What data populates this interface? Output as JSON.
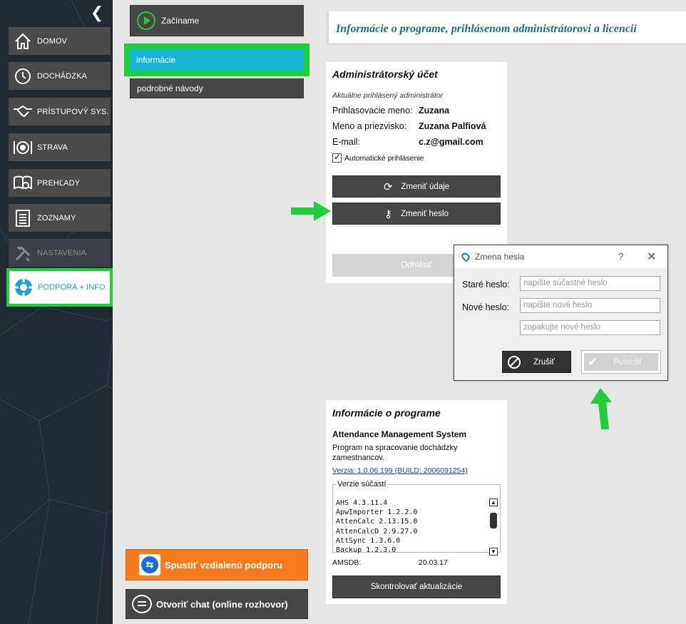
{
  "sidebar": {
    "items": [
      {
        "label": "DOMOV",
        "icon": "home-icon"
      },
      {
        "label": "DOCHÁDZKA",
        "icon": "clock-icon"
      },
      {
        "label": "PRÍSTUPOVÝ SYS.",
        "icon": "handshake-icon"
      },
      {
        "label": "STRAVA",
        "icon": "plate-icon"
      },
      {
        "label": "PREHĽADY",
        "icon": "book-search-icon"
      },
      {
        "label": "ZOZNAMY",
        "icon": "list-icon"
      },
      {
        "label": "NASTAVENIA",
        "icon": "tools-icon"
      },
      {
        "label": "PODPORA + INFO",
        "icon": "lifebuoy-icon"
      }
    ]
  },
  "subnav": {
    "start": "Začíname",
    "info": "informácie",
    "guides": "podrobné návody",
    "remote_support": "Spustiť vzdialenú podporu",
    "chat": "Otvoriť chat (online rozhovor)"
  },
  "header": {
    "title": "Informácie o programe, prihlásenom administrátorovi a licencii"
  },
  "account": {
    "title": "Administrátorský účet",
    "subtitle": "Aktuálne prihlásený administrátor",
    "login_label": "Prihlasovacie meno:",
    "login_value": "Zuzana",
    "name_label": "Meno a priezvisko:",
    "name_value": "Zuzana Palfiová",
    "email_label": "E-mail:",
    "email_value": "c.z@gmail.com",
    "auto_login": "Automatické prihlásenie",
    "change_data": "Zmeniť údaje",
    "change_password": "Zmeniť heslo",
    "logout": "Odhlásiť"
  },
  "dialog": {
    "title": "Zmena hesla",
    "help": "?",
    "old_label": "Staré heslo:",
    "old_placeholder": "napíšte súčastné heslo",
    "new_label": "Nové heslo:",
    "new_placeholder": "napíšte nové heslo",
    "repeat_placeholder": "zopakujte nové heslo",
    "cancel": "Zrušiť",
    "confirm": "Potvrdiť"
  },
  "program": {
    "title": "Informácie o programe",
    "name": "Attendance Management System",
    "description": "Program na spracovanie dochádzky zamestnancov.",
    "version": "Verzia: 1.0.06.199 (BUILD: 2006091254)",
    "components_legend": "Verzie súčastí",
    "components": [
      "AHS 4.3.11.4",
      "ApwImporter 1.2.2.0",
      "AttenCalc 2.13.15.0",
      "AttenCalcD 2.9.27.0",
      "AttSync 1.3.6.0",
      "Backup 1.2.3.0"
    ],
    "amsdb_label": "AMSDB:",
    "amsdb_value": "20.03.17",
    "check_updates": "Skontrolovať aktualizácie"
  },
  "colors": {
    "highlight": "#1ecf3a",
    "accent": "#18b4d6",
    "orange": "#f57b1c",
    "title": "#1a6d99"
  }
}
